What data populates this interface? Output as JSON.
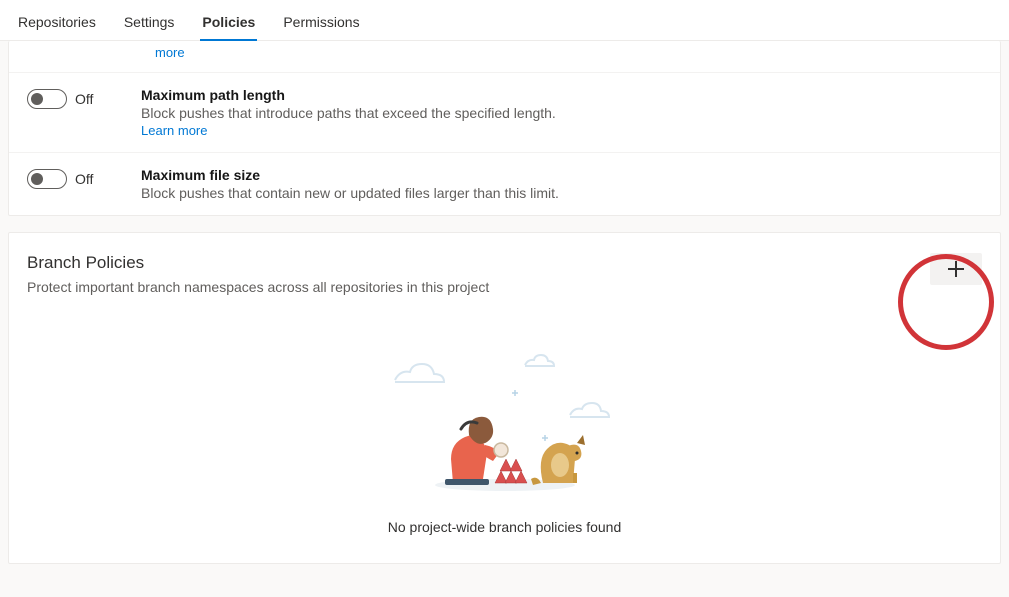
{
  "tabs": {
    "repositories": "Repositories",
    "settings": "Settings",
    "policies": "Policies",
    "permissions": "Permissions"
  },
  "truncated_more": "more",
  "policies": [
    {
      "state": "Off",
      "title": "Maximum path length",
      "desc": "Block pushes that introduce paths that exceed the specified length.",
      "learn": "Learn more"
    },
    {
      "state": "Off",
      "title": "Maximum file size",
      "desc": "Block pushes that contain new or updated files larger than this limit."
    }
  ],
  "branch": {
    "title": "Branch Policies",
    "subtitle": "Protect important branch namespaces across all repositories in this project",
    "empty": "No project-wide branch policies found"
  }
}
